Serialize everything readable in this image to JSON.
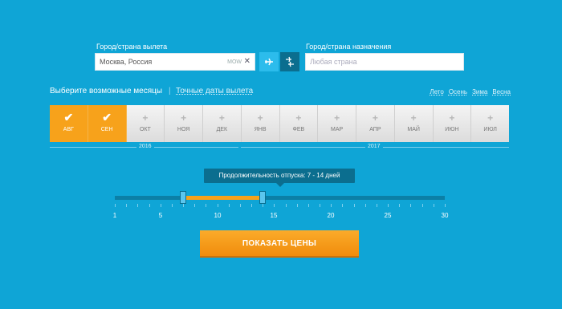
{
  "origin": {
    "label": "Город/страна вылета",
    "value": "Москва, Россия",
    "code": "MOW",
    "clear": "✕"
  },
  "destination": {
    "label": "Город/страна назначения",
    "placeholder": "Любая страна"
  },
  "tabs": {
    "active": "Выберите возможные месяцы",
    "exact": "Точные даты вылета"
  },
  "seasons": [
    "Лето",
    "Осень",
    "Зима",
    "Весна"
  ],
  "months": [
    {
      "label": "АВГ",
      "selected": true
    },
    {
      "label": "СЕН",
      "selected": true
    },
    {
      "label": "ОКТ",
      "selected": false
    },
    {
      "label": "НОЯ",
      "selected": false
    },
    {
      "label": "ДЕК",
      "selected": false
    },
    {
      "label": "ЯНВ",
      "selected": false
    },
    {
      "label": "ФЕВ",
      "selected": false
    },
    {
      "label": "МАР",
      "selected": false
    },
    {
      "label": "АПР",
      "selected": false
    },
    {
      "label": "МАЙ",
      "selected": false
    },
    {
      "label": "ИЮН",
      "selected": false
    },
    {
      "label": "ИЮЛ",
      "selected": false
    }
  ],
  "years": {
    "first": "2016",
    "second": "2017"
  },
  "duration": {
    "tooltip": "Продолжительность отпуска: 7 - 14 дней",
    "min": 1,
    "max": 30,
    "from": 7,
    "to": 14,
    "ticks": [
      "1",
      "5",
      "10",
      "15",
      "20",
      "25",
      "30"
    ]
  },
  "cta": "ПОКАЗАТЬ ЦЕНЫ",
  "colors": {
    "background": "#0fa5d6",
    "accent": "#f7a21b"
  }
}
